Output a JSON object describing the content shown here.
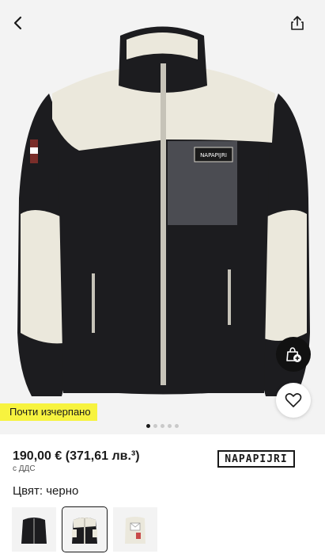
{
  "header": {
    "back_icon": "chevron-left-icon",
    "share_icon": "share-icon"
  },
  "product": {
    "stock_badge": "Почти изчерпано",
    "gallery": {
      "total": 5,
      "active": 1
    },
    "price_main": "190,00 €",
    "price_alt": "(371,61 лв.³)",
    "vat_note": "с ДДС",
    "brand": "NAPAPIJRI",
    "color_line": "Цвят: черно",
    "jacket_label": "NAPAPIJRI"
  },
  "actions": {
    "add_to_bag_icon": "bag-plus-icon",
    "wishlist_icon": "heart-icon"
  },
  "swatches": [
    {
      "name": "black",
      "selected": false
    },
    {
      "name": "black-white",
      "selected": true
    },
    {
      "name": "white",
      "selected": false
    }
  ],
  "colors": {
    "badge": "#f7f33f",
    "black": "#111111",
    "fleece_cream": "#ebe8dc"
  }
}
